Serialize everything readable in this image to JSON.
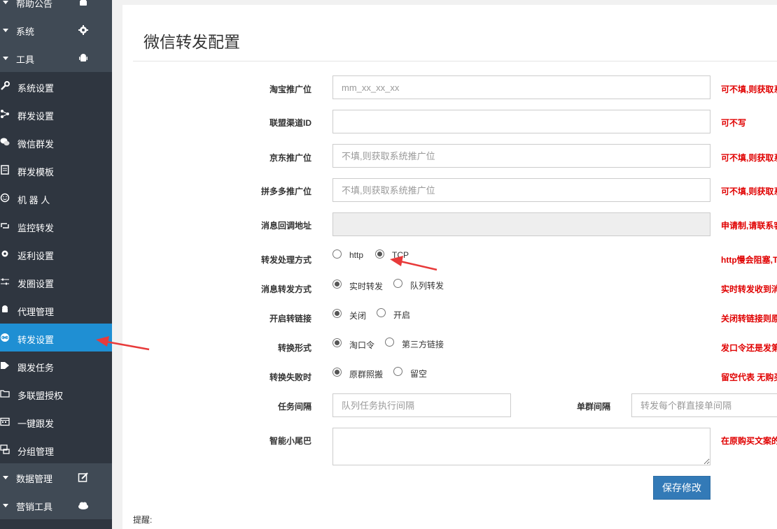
{
  "sidebar": {
    "top_items": [
      {
        "label": "帮助公告",
        "icon": "android-icon"
      },
      {
        "label": "系统",
        "icon": "gear-icon"
      },
      {
        "label": "工具",
        "icon": "android-icon"
      }
    ],
    "tool_items": [
      {
        "label": "系统设置",
        "icon": "wrench-icon"
      },
      {
        "label": "群发设置",
        "icon": "share-nodes-icon"
      },
      {
        "label": "微信群发",
        "icon": "wechat-icon"
      },
      {
        "label": "群发模板",
        "icon": "document-icon"
      },
      {
        "label": "机 器 人",
        "icon": "smile-icon"
      },
      {
        "label": "监控转发",
        "icon": "retweet-icon"
      },
      {
        "label": "返利设置",
        "icon": "gear-icon"
      },
      {
        "label": "发圈设置",
        "icon": "sliders-icon"
      },
      {
        "label": "代理管理",
        "icon": "android-icon"
      },
      {
        "label": "转发设置",
        "icon": "link-icon",
        "active": true
      },
      {
        "label": "跟发任务",
        "icon": "tag-icon"
      },
      {
        "label": "多联盟授权",
        "icon": "folder-icon"
      },
      {
        "label": "一键跟发",
        "icon": "calendar-icon"
      },
      {
        "label": "分组管理",
        "icon": "sitemap-icon"
      }
    ],
    "bottom_items": [
      {
        "label": "数据管理",
        "icon": "edit-icon"
      },
      {
        "label": "营销工具",
        "icon": "cloud-icon"
      }
    ]
  },
  "page": {
    "title": "微信转发配置",
    "reminder": "提醒:",
    "save_label": "保存修改"
  },
  "form": {
    "taobao_pid": {
      "label": "淘宝推广位",
      "value": "",
      "placeholder": "mm_xx_xx_xx",
      "hint": "可不填,则获取系"
    },
    "channel_id": {
      "label": "联盟渠道ID",
      "value": "",
      "placeholder": "",
      "hint": "可不写"
    },
    "jd_pid": {
      "label": "京东推广位",
      "value": "",
      "placeholder": "不填,则获取系统推广位",
      "hint": "可不填,则获取系"
    },
    "pdd_pid": {
      "label": "拼多多推广位",
      "value": "",
      "placeholder": "不填,则获取系统推广位",
      "hint": "可不填,则获取系"
    },
    "callback_url": {
      "label": "消息回调地址",
      "value": "",
      "hint": "申请制,请联系客"
    },
    "forward_mode": {
      "label": "转发处理方式",
      "options": [
        "http",
        "TCP"
      ],
      "selected": "TCP",
      "hint": "http慢会阻塞,T"
    },
    "msg_forward_mode": {
      "label": "消息转发方式",
      "options": [
        "实时转发",
        "队列转发"
      ],
      "selected": "实时转发",
      "hint": "实时转发收到消"
    },
    "convert_link": {
      "label": "开启转链接",
      "options": [
        "关闭",
        "开启"
      ],
      "selected": "关闭",
      "hint": "关闭转链接则原"
    },
    "convert_format": {
      "label": "转换形式",
      "options": [
        "淘口令",
        "第三方链接"
      ],
      "selected": "淘口令",
      "hint": "发口令还是发第"
    },
    "on_fail": {
      "label": "转换失败时",
      "options": [
        "原群照搬",
        "留空"
      ],
      "selected": "原群照搬",
      "hint": "留空代表 无购买"
    },
    "task_interval": {
      "label": "任务间隔",
      "value": "",
      "placeholder": "队列任务执行间隔"
    },
    "group_interval": {
      "label": "单群间隔",
      "value": "",
      "placeholder": "转发每个群直接单间隔"
    },
    "tail": {
      "label": "智能小尾巴",
      "value": "",
      "hint": "在原购买文案的"
    }
  },
  "colors": {
    "sidebar_bg": "#2f3640",
    "sidebar_header_bg": "#404a55",
    "active_item": "#1f8fd3",
    "hint_red": "#e00000",
    "primary_button": "#337ab7",
    "annotation_arrow": "#e83a3a"
  }
}
